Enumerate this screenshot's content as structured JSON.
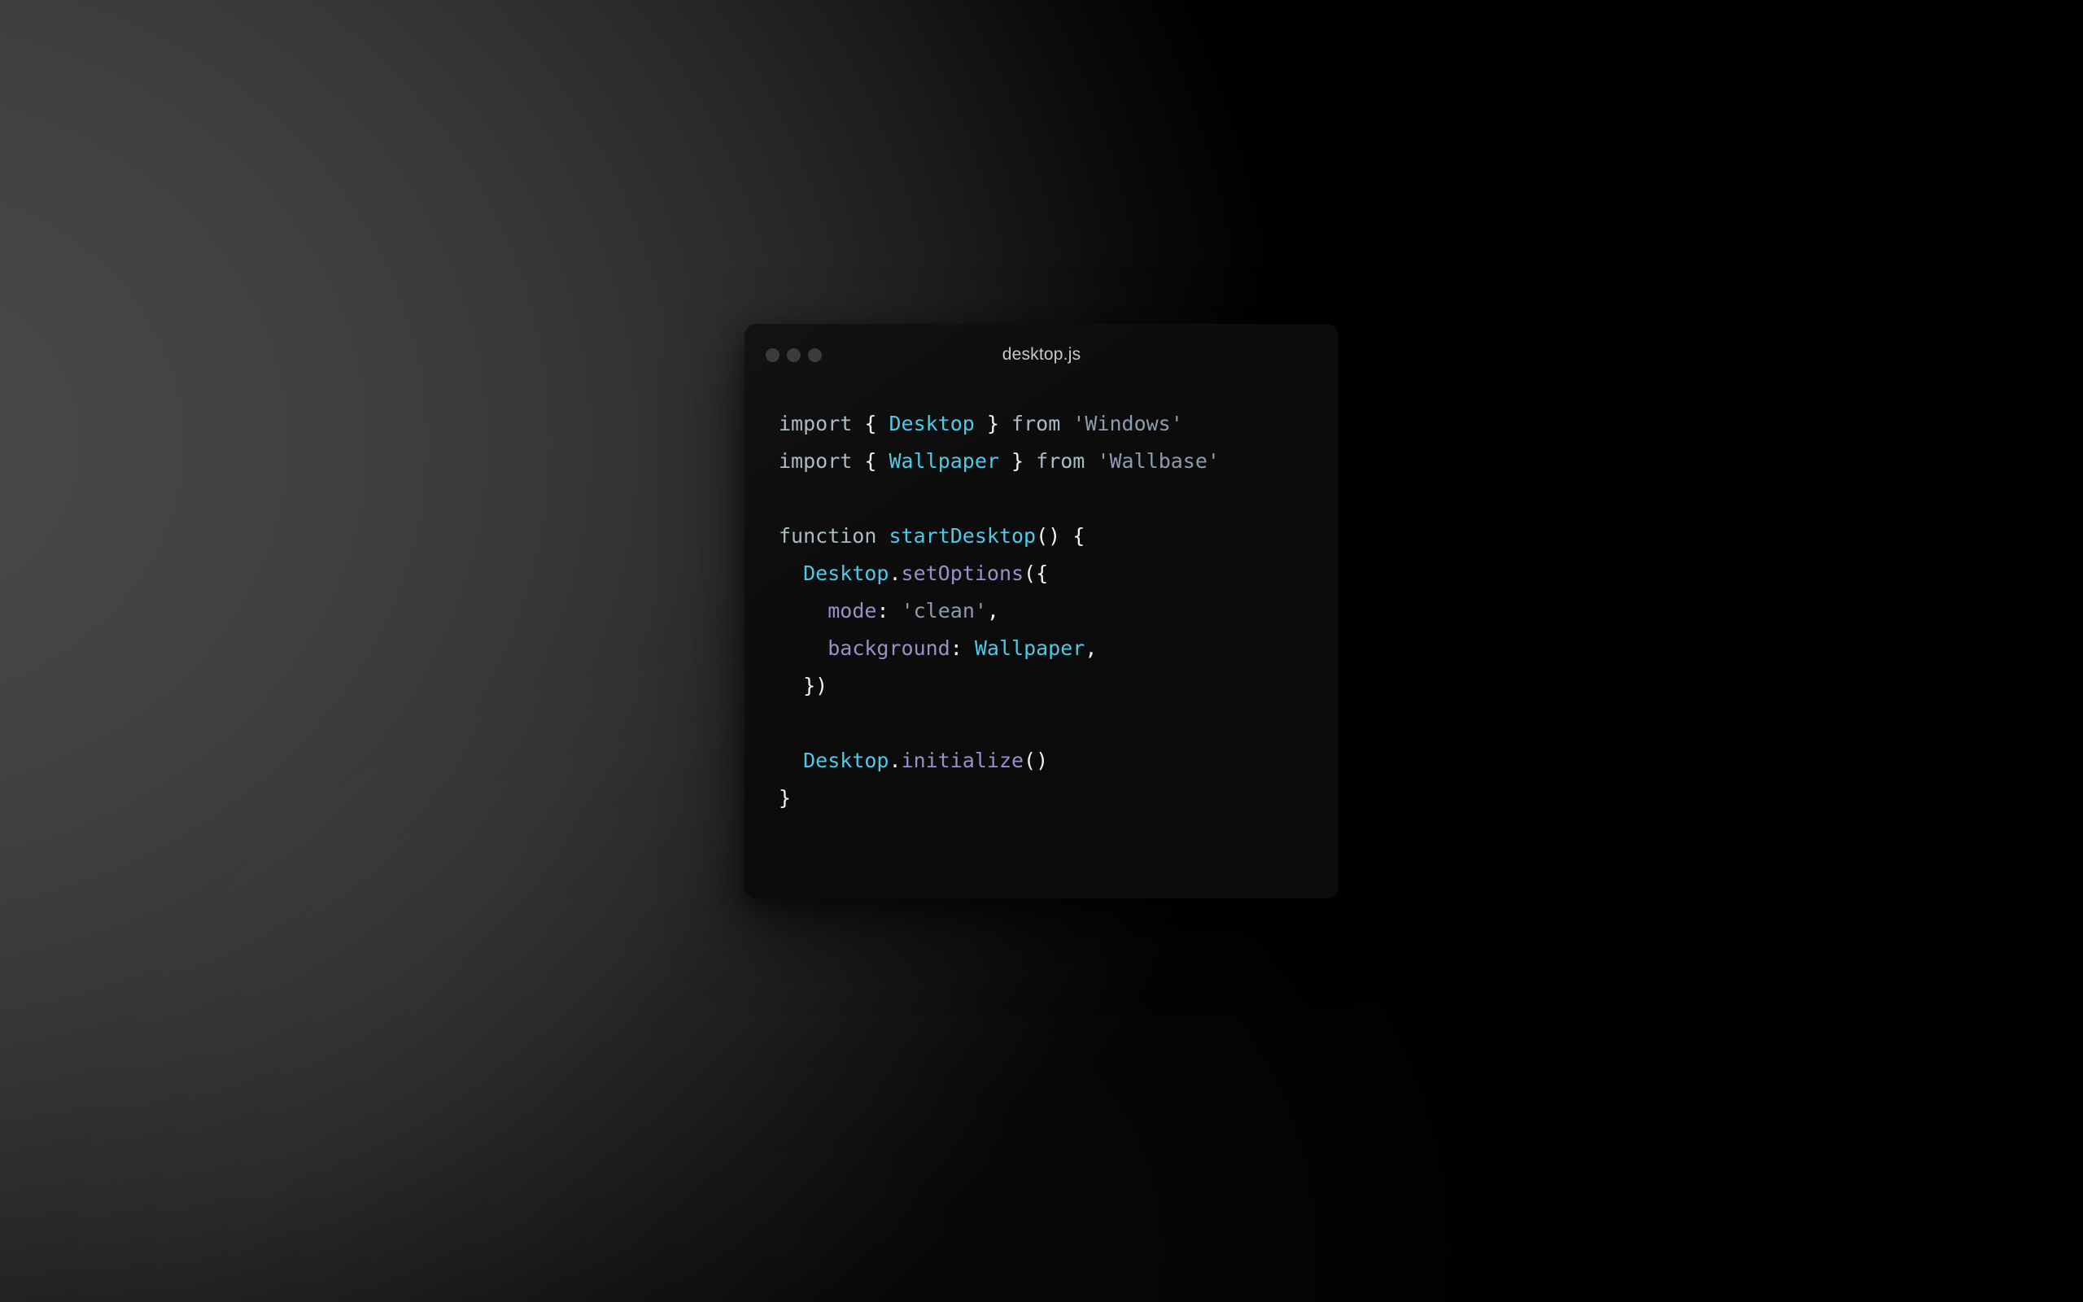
{
  "wallpaper": {
    "style": "dark-radial-gradient",
    "light_color": "#4a4a4a",
    "dark_color": "#000000"
  },
  "window": {
    "title": "desktop.js",
    "background": "#0b0b0b",
    "traffic_lights": [
      {
        "name": "close",
        "color": "#3c3c3c"
      },
      {
        "name": "minimize",
        "color": "#3c3c3c"
      },
      {
        "name": "maximize",
        "color": "#3c3c3c"
      }
    ]
  },
  "editor": {
    "language": "javascript",
    "theme_colors": {
      "keyword": "#a9bcc4",
      "class": "#4ec9e8",
      "method": "#9b8fc7",
      "property": "#9b8fc7",
      "string": "#8c9cae",
      "punctuation": "#f2f2f2",
      "plain": "#e8e8e8"
    },
    "code_text": "import { Desktop } from 'Windows'\nimport { Wallpaper } from 'Wallbase'\n\nfunction startDesktop() {\n  Desktop.setOptions({\n    mode: 'clean',\n    background: Wallpaper,\n  })\n\n  Desktop.initialize()\n}",
    "lines": [
      {
        "n": 1,
        "tokens": [
          {
            "t": "import",
            "c": "keyword"
          },
          {
            "t": " ",
            "c": "plain"
          },
          {
            "t": "{",
            "c": "punct"
          },
          {
            "t": " ",
            "c": "plain"
          },
          {
            "t": "Desktop",
            "c": "class"
          },
          {
            "t": " ",
            "c": "plain"
          },
          {
            "t": "}",
            "c": "punct"
          },
          {
            "t": " ",
            "c": "plain"
          },
          {
            "t": "from",
            "c": "keyword"
          },
          {
            "t": " ",
            "c": "plain"
          },
          {
            "t": "'Windows'",
            "c": "string"
          }
        ]
      },
      {
        "n": 2,
        "tokens": [
          {
            "t": "import",
            "c": "keyword"
          },
          {
            "t": " ",
            "c": "plain"
          },
          {
            "t": "{",
            "c": "punct"
          },
          {
            "t": " ",
            "c": "plain"
          },
          {
            "t": "Wallpaper",
            "c": "class"
          },
          {
            "t": " ",
            "c": "plain"
          },
          {
            "t": "}",
            "c": "punct"
          },
          {
            "t": " ",
            "c": "plain"
          },
          {
            "t": "from",
            "c": "keyword"
          },
          {
            "t": " ",
            "c": "plain"
          },
          {
            "t": "'Wallbase'",
            "c": "string"
          }
        ]
      },
      {
        "n": 3,
        "tokens": []
      },
      {
        "n": 4,
        "tokens": [
          {
            "t": "function",
            "c": "keyword"
          },
          {
            "t": " ",
            "c": "plain"
          },
          {
            "t": "startDesktop",
            "c": "class"
          },
          {
            "t": "()",
            "c": "punct"
          },
          {
            "t": " ",
            "c": "plain"
          },
          {
            "t": "{",
            "c": "punct"
          }
        ]
      },
      {
        "n": 5,
        "tokens": [
          {
            "t": "  ",
            "c": "plain"
          },
          {
            "t": "Desktop",
            "c": "class"
          },
          {
            "t": ".",
            "c": "punct"
          },
          {
            "t": "setOptions",
            "c": "method"
          },
          {
            "t": "({",
            "c": "punct"
          }
        ]
      },
      {
        "n": 6,
        "tokens": [
          {
            "t": "    ",
            "c": "plain"
          },
          {
            "t": "mode",
            "c": "prop"
          },
          {
            "t": ":",
            "c": "punct"
          },
          {
            "t": " ",
            "c": "plain"
          },
          {
            "t": "'clean'",
            "c": "string"
          },
          {
            "t": ",",
            "c": "punct"
          }
        ]
      },
      {
        "n": 7,
        "tokens": [
          {
            "t": "    ",
            "c": "plain"
          },
          {
            "t": "background",
            "c": "prop"
          },
          {
            "t": ":",
            "c": "punct"
          },
          {
            "t": " ",
            "c": "plain"
          },
          {
            "t": "Wallpaper",
            "c": "class"
          },
          {
            "t": ",",
            "c": "punct"
          }
        ]
      },
      {
        "n": 8,
        "tokens": [
          {
            "t": "  ",
            "c": "plain"
          },
          {
            "t": "})",
            "c": "punct"
          }
        ]
      },
      {
        "n": 9,
        "tokens": []
      },
      {
        "n": 10,
        "tokens": [
          {
            "t": "  ",
            "c": "plain"
          },
          {
            "t": "Desktop",
            "c": "class"
          },
          {
            "t": ".",
            "c": "punct"
          },
          {
            "t": "initialize",
            "c": "method"
          },
          {
            "t": "()",
            "c": "punct"
          }
        ]
      },
      {
        "n": 11,
        "tokens": [
          {
            "t": "}",
            "c": "punct"
          }
        ]
      }
    ]
  }
}
